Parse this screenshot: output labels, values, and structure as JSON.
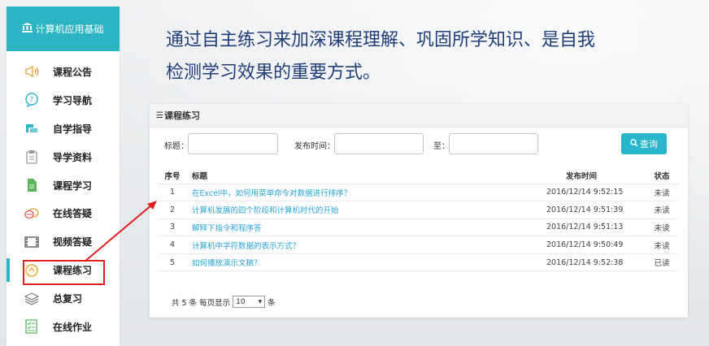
{
  "sidebar": {
    "header_icon": "bank-icon",
    "title": "计算机应用基础",
    "items": [
      {
        "label": "课程公告",
        "icon": "megaphone-icon"
      },
      {
        "label": "学习导航",
        "icon": "chat-bubble-icon"
      },
      {
        "label": "自学指导",
        "icon": "folder-icon"
      },
      {
        "label": "导学资料",
        "icon": "clipboard-icon"
      },
      {
        "label": "课程学习",
        "icon": "document-icon"
      },
      {
        "label": "在线答疑",
        "icon": "chat-dots-icon"
      },
      {
        "label": "视频答疑",
        "icon": "film-icon"
      },
      {
        "label": "课程练习",
        "icon": "gauge-icon",
        "active": true
      },
      {
        "label": "总复习",
        "icon": "layers-icon"
      },
      {
        "label": "在线作业",
        "icon": "checklist-icon"
      }
    ]
  },
  "intro_line1": "通过自主练习来加深课程理解、巩固所学知识、是自我",
  "intro_line2": "检测学习效果的重要方式。",
  "panel": {
    "title": "课程练习",
    "filter": {
      "title_label": "标题：",
      "date_label": "发布时间：",
      "to_label": "至：",
      "search_label": "查询"
    },
    "columns": {
      "no": "序号",
      "title": "标题",
      "date": "发布时间",
      "status": "状态"
    },
    "rows": [
      {
        "no": "1",
        "title": "在Excel中，如何用菜单命令对数据进行排序？",
        "date": "2016/12/14 9:52:15",
        "status": "未读"
      },
      {
        "no": "2",
        "title": "计算机发展的四个阶段和计算机时代的开始",
        "date": "2016/12/14 9:51:39",
        "status": "未读"
      },
      {
        "no": "3",
        "title": "解释下指令和程序答",
        "date": "2016/12/14 9:51:13",
        "status": "未读"
      },
      {
        "no": "4",
        "title": "计算机中字符数据的表示方式？",
        "date": "2016/12/14 9:50:49",
        "status": "未读"
      },
      {
        "no": "5",
        "title": "如何播放演示文稿？",
        "date": "2016/12/14 9:52:38",
        "status": "已读"
      }
    ],
    "pager": {
      "prefix": "共 5 条 每页显示",
      "page_size": "10",
      "suffix": "条"
    }
  },
  "colors": {
    "accent": "#2bb5c4",
    "heading": "#1f3e7a",
    "link": "#2aa6d4",
    "annotation": "#e02020"
  }
}
